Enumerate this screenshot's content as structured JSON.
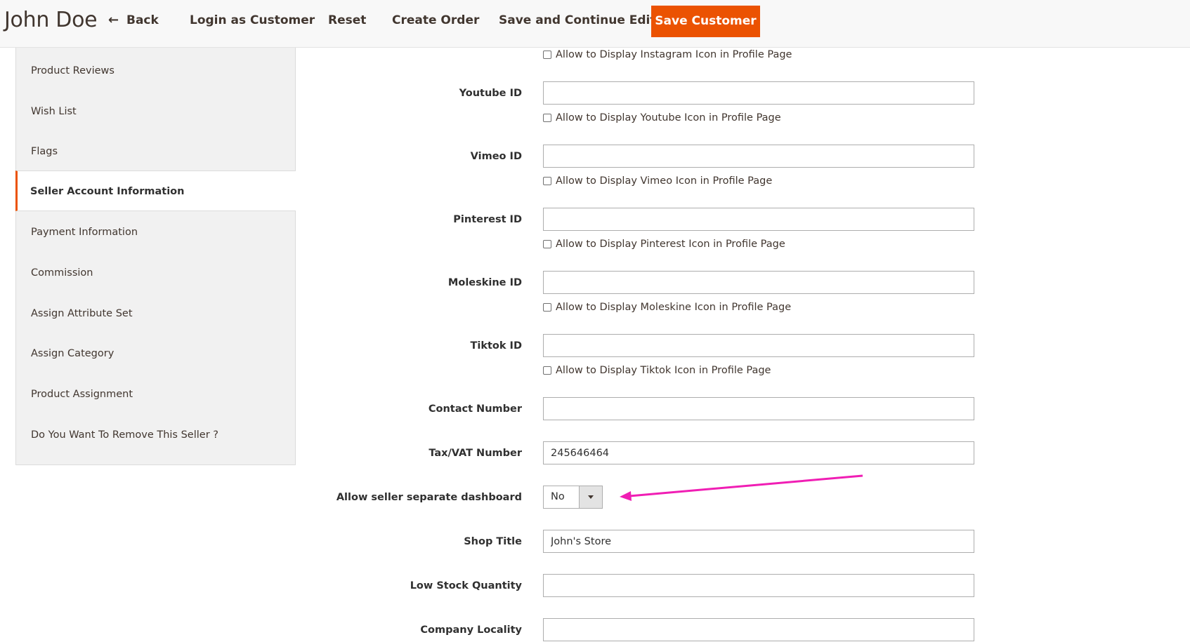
{
  "header": {
    "title": "John Doe",
    "back_label": "Back",
    "login_label": "Login as Customer",
    "reset_label": "Reset",
    "create_order_label": "Create Order",
    "save_continue_label": "Save and Continue Edit",
    "save_customer_label": "Save Customer"
  },
  "sidebar": {
    "items": [
      {
        "label": "Product Reviews"
      },
      {
        "label": "Wish List"
      },
      {
        "label": "Flags"
      },
      {
        "label": "Seller Account Information",
        "active": true
      },
      {
        "label": "Payment Information"
      },
      {
        "label": "Commission"
      },
      {
        "label": "Assign Attribute Set"
      },
      {
        "label": "Assign Category"
      },
      {
        "label": "Product Assignment"
      },
      {
        "label": "Do You Want To Remove This Seller ?"
      }
    ]
  },
  "form": {
    "instagram_checkbox": "Allow to Display Instagram Icon in Profile Page",
    "youtube": {
      "label": "Youtube ID",
      "value": "",
      "checkbox": "Allow to Display Youtube Icon in Profile Page"
    },
    "vimeo": {
      "label": "Vimeo ID",
      "value": "",
      "checkbox": "Allow to Display Vimeo Icon in Profile Page"
    },
    "pinterest": {
      "label": "Pinterest ID",
      "value": "",
      "checkbox": "Allow to Display Pinterest Icon in Profile Page"
    },
    "moleskine": {
      "label": "Moleskine ID",
      "value": "",
      "checkbox": "Allow to Display Moleskine Icon in Profile Page"
    },
    "tiktok": {
      "label": "Tiktok ID",
      "value": "",
      "checkbox": "Allow to Display Tiktok Icon in Profile Page"
    },
    "contact_number": {
      "label": "Contact Number",
      "value": ""
    },
    "tax_vat": {
      "label": "Tax/VAT Number",
      "value": "245646464"
    },
    "separate_dashboard": {
      "label": "Allow seller separate dashboard",
      "value": "No"
    },
    "shop_title": {
      "label": "Shop Title",
      "value": "John's Store"
    },
    "low_stock": {
      "label": "Low Stock Quantity",
      "value": ""
    },
    "company_locality": {
      "label": "Company Locality",
      "value": ""
    }
  },
  "colors": {
    "accent": "#eb5202",
    "annotation_arrow": "#f01eb4"
  }
}
